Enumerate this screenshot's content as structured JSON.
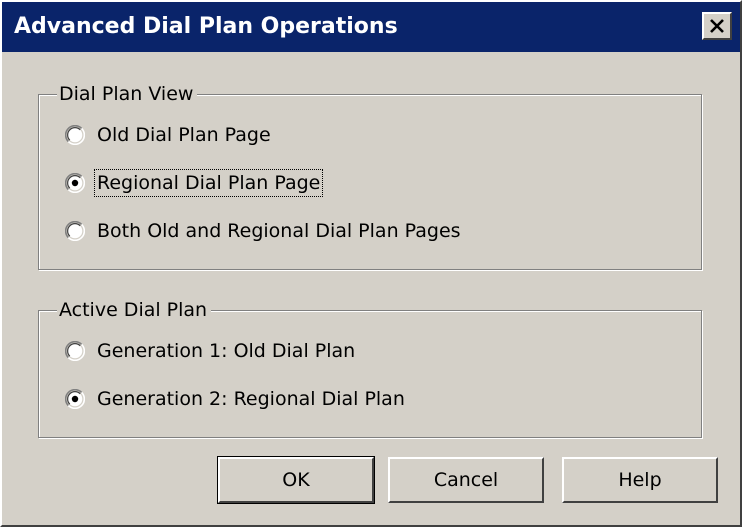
{
  "window": {
    "title": "Advanced Dial Plan Operations",
    "close_icon": "close-icon"
  },
  "dial_plan_view": {
    "legend": "Dial Plan View",
    "options": [
      {
        "label": "Old Dial Plan Page",
        "selected": false
      },
      {
        "label": "Regional Dial Plan Page",
        "selected": true
      },
      {
        "label": "Both Old and Regional Dial Plan Pages",
        "selected": false
      }
    ]
  },
  "active_dial_plan": {
    "legend": "Active Dial Plan",
    "options": [
      {
        "label": "Generation 1: Old Dial Plan",
        "selected": false
      },
      {
        "label": "Generation 2: Regional Dial Plan",
        "selected": true
      }
    ]
  },
  "buttons": {
    "ok": "OK",
    "cancel": "Cancel",
    "help": "Help"
  },
  "colors": {
    "titlebar": "#0a246a",
    "face": "#d4d0c8"
  }
}
